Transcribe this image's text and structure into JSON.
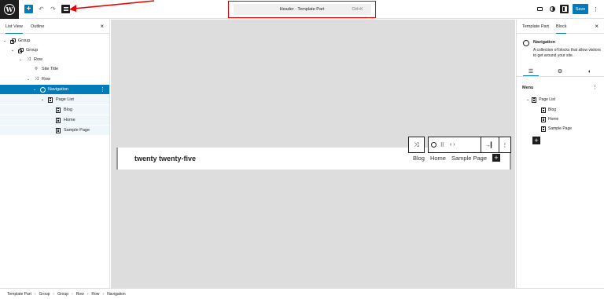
{
  "toolbar": {
    "add_icon": "plus-icon",
    "undo_icon": "undo-icon",
    "redo_icon": "redo-icon",
    "document_title": "Header · Template Part",
    "command_shortcut": "Ctrl+K",
    "save_label": "Save"
  },
  "left_panel": {
    "tabs": [
      "List View",
      "Outline"
    ],
    "tree": [
      {
        "label": "Group",
        "icon": "group-icon"
      },
      {
        "label": "Group",
        "icon": "group-icon"
      },
      {
        "label": "Row",
        "icon": "row-icon"
      },
      {
        "label": "Site Title",
        "icon": "map-marker-icon"
      },
      {
        "label": "Row",
        "icon": "row-icon"
      },
      {
        "label": "Navigation",
        "icon": "navigation-icon"
      },
      {
        "label": "Page List",
        "icon": "page-list-icon"
      },
      {
        "label": "Blog",
        "icon": "page-icon"
      },
      {
        "label": "Home",
        "icon": "page-icon"
      },
      {
        "label": "Sample Page",
        "icon": "page-icon"
      }
    ]
  },
  "canvas": {
    "site_title": "twenty twenty-five",
    "nav": [
      "Blog",
      "Home",
      "Sample Page"
    ]
  },
  "right_panel": {
    "tabs": [
      "Template Part",
      "Block"
    ],
    "block_name": "Navigation",
    "block_description": "A collection of blocks that allow visitors to get around your site.",
    "menu_label": "Menu",
    "menu_items": [
      {
        "label": "Page List"
      },
      {
        "label": "Blog"
      },
      {
        "label": "Home"
      },
      {
        "label": "Sample Page"
      }
    ]
  },
  "breadcrumb": [
    "Template Part",
    "Group",
    "Group",
    "Row",
    "Row",
    "Navigation"
  ],
  "colors": {
    "accent": "#007cba",
    "highlight_border": "#e00000",
    "canvas_bg": "#dddddd"
  }
}
